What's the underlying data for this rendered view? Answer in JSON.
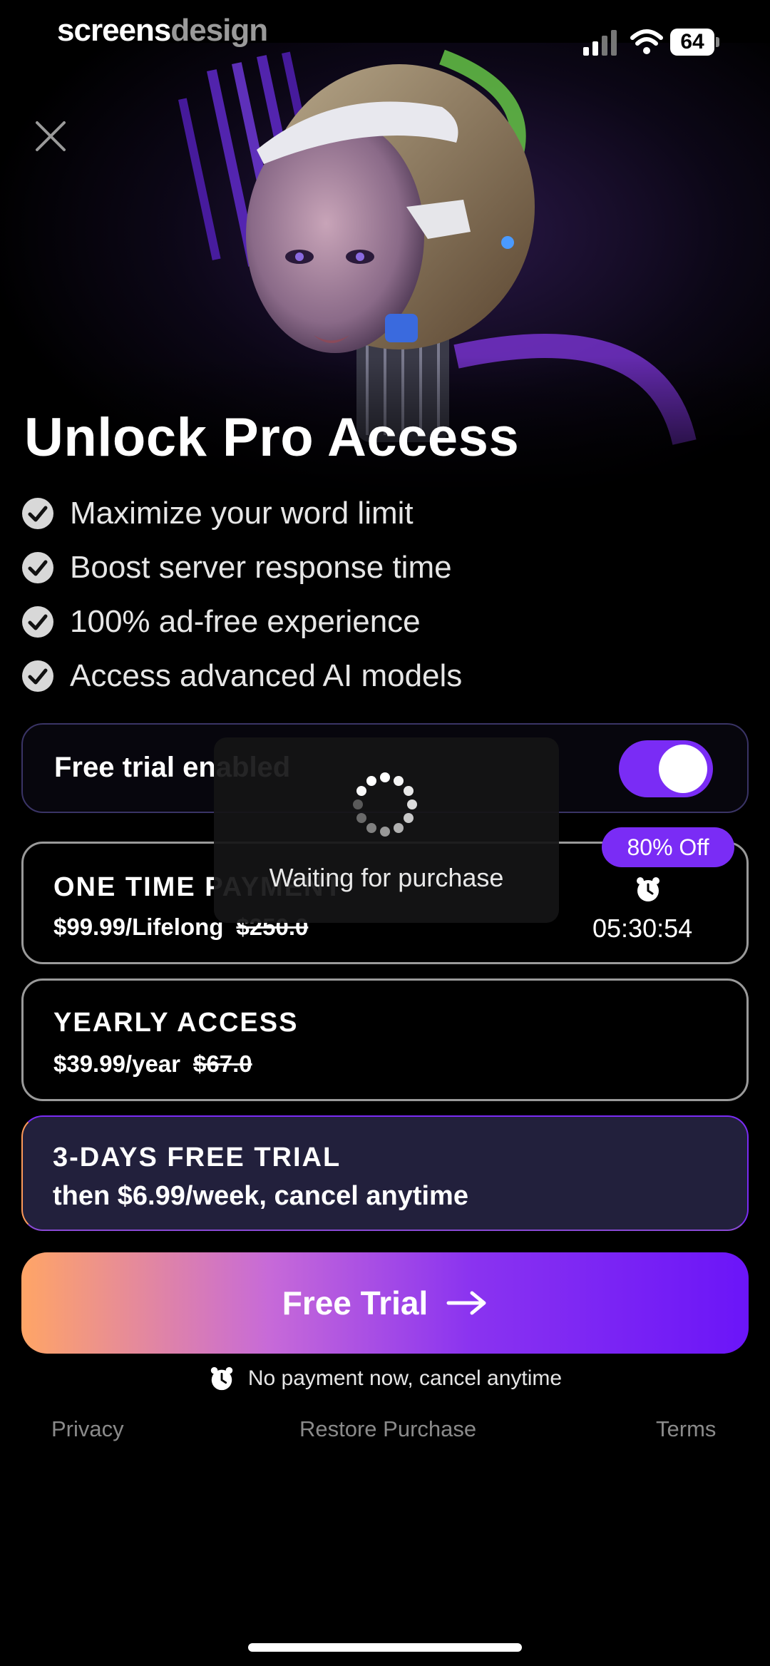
{
  "status_bar": {
    "watermark_part1": "screens",
    "watermark_part2": "design",
    "battery_level": "64"
  },
  "hero": {
    "title": "Unlock Pro Access",
    "close_icon": "close-icon"
  },
  "features": [
    {
      "text": "Maximize your word limit",
      "icon": "check-circle-icon"
    },
    {
      "text": "Boost server response time",
      "icon": "check-circle-icon"
    },
    {
      "text": "100% ad-free experience",
      "icon": "check-circle-icon"
    },
    {
      "text": "Access advanced AI models",
      "icon": "check-circle-icon"
    }
  ],
  "free_trial_toggle": {
    "label": "Free trial enabled",
    "enabled": true
  },
  "plans": {
    "one_time": {
      "name": "ONE TIME PAYMENT",
      "price": "$99.99/Lifelong",
      "original_price": "$250.0",
      "badge": "80% Off",
      "timer": "05:30:54",
      "timer_icon": "alarm-clock-icon"
    },
    "yearly": {
      "name": "YEARLY ACCESS",
      "price": "$39.99/year",
      "original_price": "$67.0"
    },
    "trial": {
      "name": "3-DAYS FREE TRIAL",
      "subtitle": "then $6.99/week, cancel anytime",
      "selected": true
    }
  },
  "cta": {
    "label": "Free Trial",
    "icon": "arrow-right-icon"
  },
  "note": {
    "text": "No payment now, cancel anytime",
    "icon": "alarm-clock-icon"
  },
  "footer": {
    "privacy": "Privacy",
    "restore": "Restore Purchase",
    "terms": "Terms"
  },
  "loading_overlay": {
    "text": "Waiting for purchase"
  },
  "colors": {
    "accent": "#7a2cf5",
    "gradient_start": "#ffa566",
    "gradient_end": "#6b15f8",
    "trial_card_bg": "#22203c",
    "background": "#000000"
  }
}
